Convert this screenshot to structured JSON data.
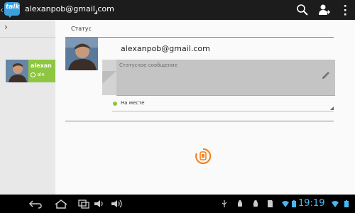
{
  "action_bar": {
    "logo_text": "talk",
    "account": "alexanpob@gmail.com",
    "icons": [
      "search-icon",
      "add-friend-icon",
      "overflow-menu-icon"
    ],
    "logo_color": "#3aa0e0"
  },
  "left_pane": {
    "contact": {
      "name_fragment": "alexan",
      "status_fragment": "ale"
    }
  },
  "main": {
    "section_title": "Статус",
    "email": "alexanpob@gmail.com",
    "status_placeholder": "Статусное сообщение",
    "presence_label": "На месте",
    "presence_color": "#8dc63f",
    "spinner_color": "#f58220"
  },
  "system_bar": {
    "time": "19:19",
    "time_color": "#4ab6f0"
  }
}
